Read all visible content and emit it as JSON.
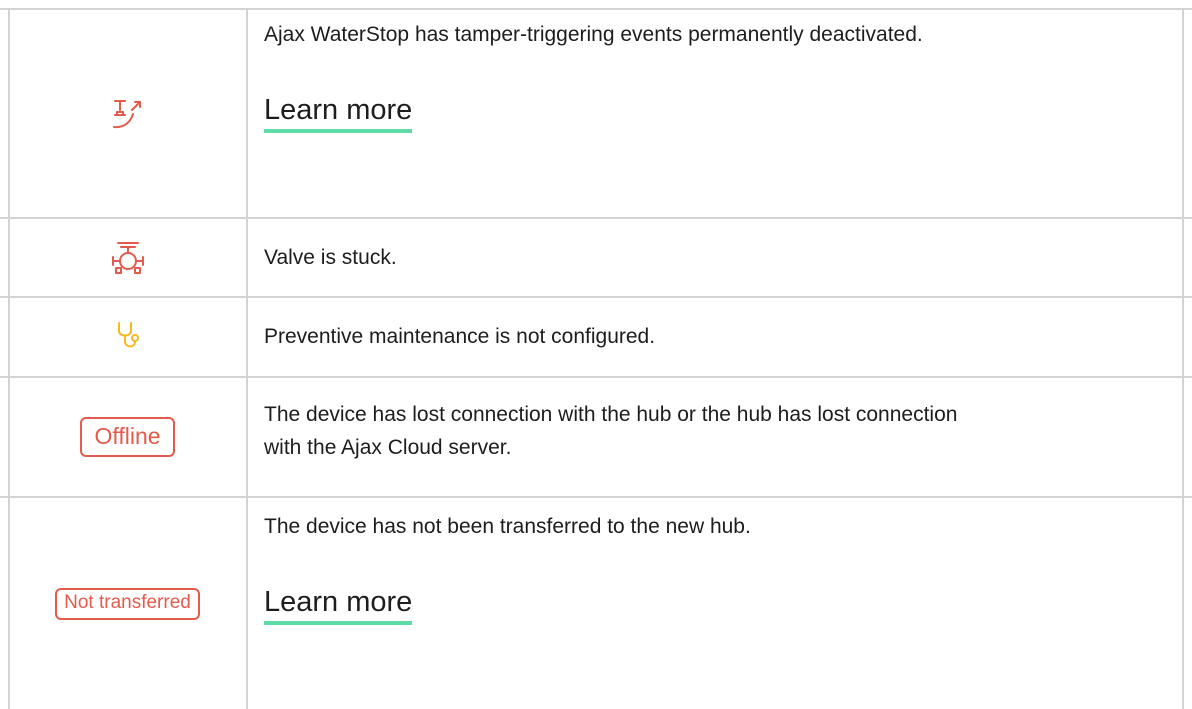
{
  "rows": [
    {
      "icon": "tamper-deactivated-icon",
      "icon_color": "#e25b4c",
      "description": "Ajax WaterStop has tamper-triggering events permanently deactivated.",
      "link": "Learn more"
    },
    {
      "icon": "valve-stuck-icon",
      "icon_color": "#e25b4c",
      "description": "Valve is stuck."
    },
    {
      "icon": "stethoscope-icon",
      "icon_color": "#f5b922",
      "description": "Preventive maintenance is not configured."
    },
    {
      "badge": "Offline",
      "badge_color": "#e25b4c",
      "description": "The device has lost connection with the hub or the hub has lost connection with the Ajax Cloud server."
    },
    {
      "badge": "Not transferred",
      "badge_color": "#e25b4c",
      "description": "The device has not been transferred to the new hub.",
      "link": "Learn more"
    }
  ],
  "colors": {
    "link_underline": "#5fdca6",
    "border": "#d4d4d4",
    "text": "#1d1d1d"
  }
}
